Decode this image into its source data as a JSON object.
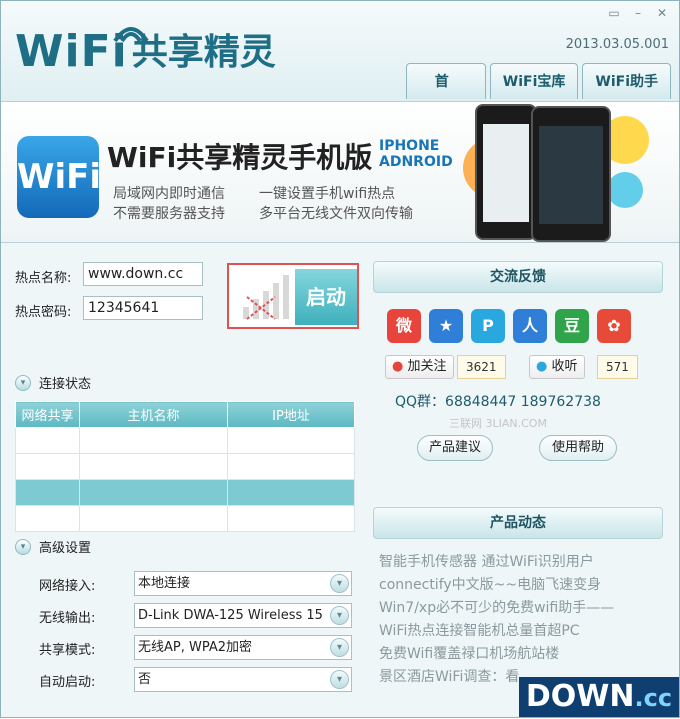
{
  "app": {
    "logo_wifi": "WiFi",
    "logo_cn": "共享精灵",
    "version": "2013.03.05.001",
    "window_controls": [
      "skin-icon",
      "minimize-icon",
      "close-icon"
    ]
  },
  "tabs": [
    "首 页",
    "WiFi宝库",
    "WiFi助手"
  ],
  "banner": {
    "logo_text": "WiFi",
    "title": "WiFi共享精灵手机版",
    "sub1": "IPHONE",
    "sub2": "ADNROID",
    "feature1": "局域网内即时通信",
    "feature2": "不需要服务器支持",
    "feature3": "一键设置手机wifi热点",
    "feature4": "多平台无线文件双向传输"
  },
  "hotspot": {
    "name_label": "热点名称:",
    "name_value": "www.down.cc",
    "password_label": "热点密码:",
    "password_value": "12345641",
    "start_label": "启动"
  },
  "connection": {
    "section_label": "连接状态",
    "columns": [
      "网络共享",
      "主机名称",
      "IP地址"
    ]
  },
  "advanced": {
    "section_label": "高级设置",
    "network_in_label": "网络接入:",
    "network_in_value": "本地连接",
    "wireless_out_label": "无线输出:",
    "wireless_out_value": "D-Link DWA-125 Wireless 15",
    "share_mode_label": "共享模式:",
    "share_mode_value": "无线AP, WPA2加密",
    "autostart_label": "自动启动:",
    "autostart_value": "否"
  },
  "feedback": {
    "header": "交流反馈",
    "follow_label": "加关注",
    "follow_count": "3621",
    "listen_label": "收听",
    "listen_count": "571",
    "qq": "QQ群：68848447 189762738",
    "watermark": "三联网 3LIAN.COM",
    "suggest_label": "产品建议",
    "help_label": "使用帮助"
  },
  "news": {
    "header": "产品动态",
    "items": [
      "智能手机传感器 通过WiFi识别用户",
      "connectify中文版~~电脑飞速变身",
      "Win7/xp必不可少的免费wifi助手——",
      "WiFi热点连接智能机总量首超PC",
      "免费Wifi覆盖禄口机场航站楼",
      "景区酒店WiFi调查：看"
    ]
  },
  "watermark_logo": {
    "main": "DOWN",
    "suffix": ".cc"
  },
  "colors": {
    "accent": "#5cb8c2",
    "brand": "#1e6f86",
    "highlight_border": "#e05252"
  }
}
